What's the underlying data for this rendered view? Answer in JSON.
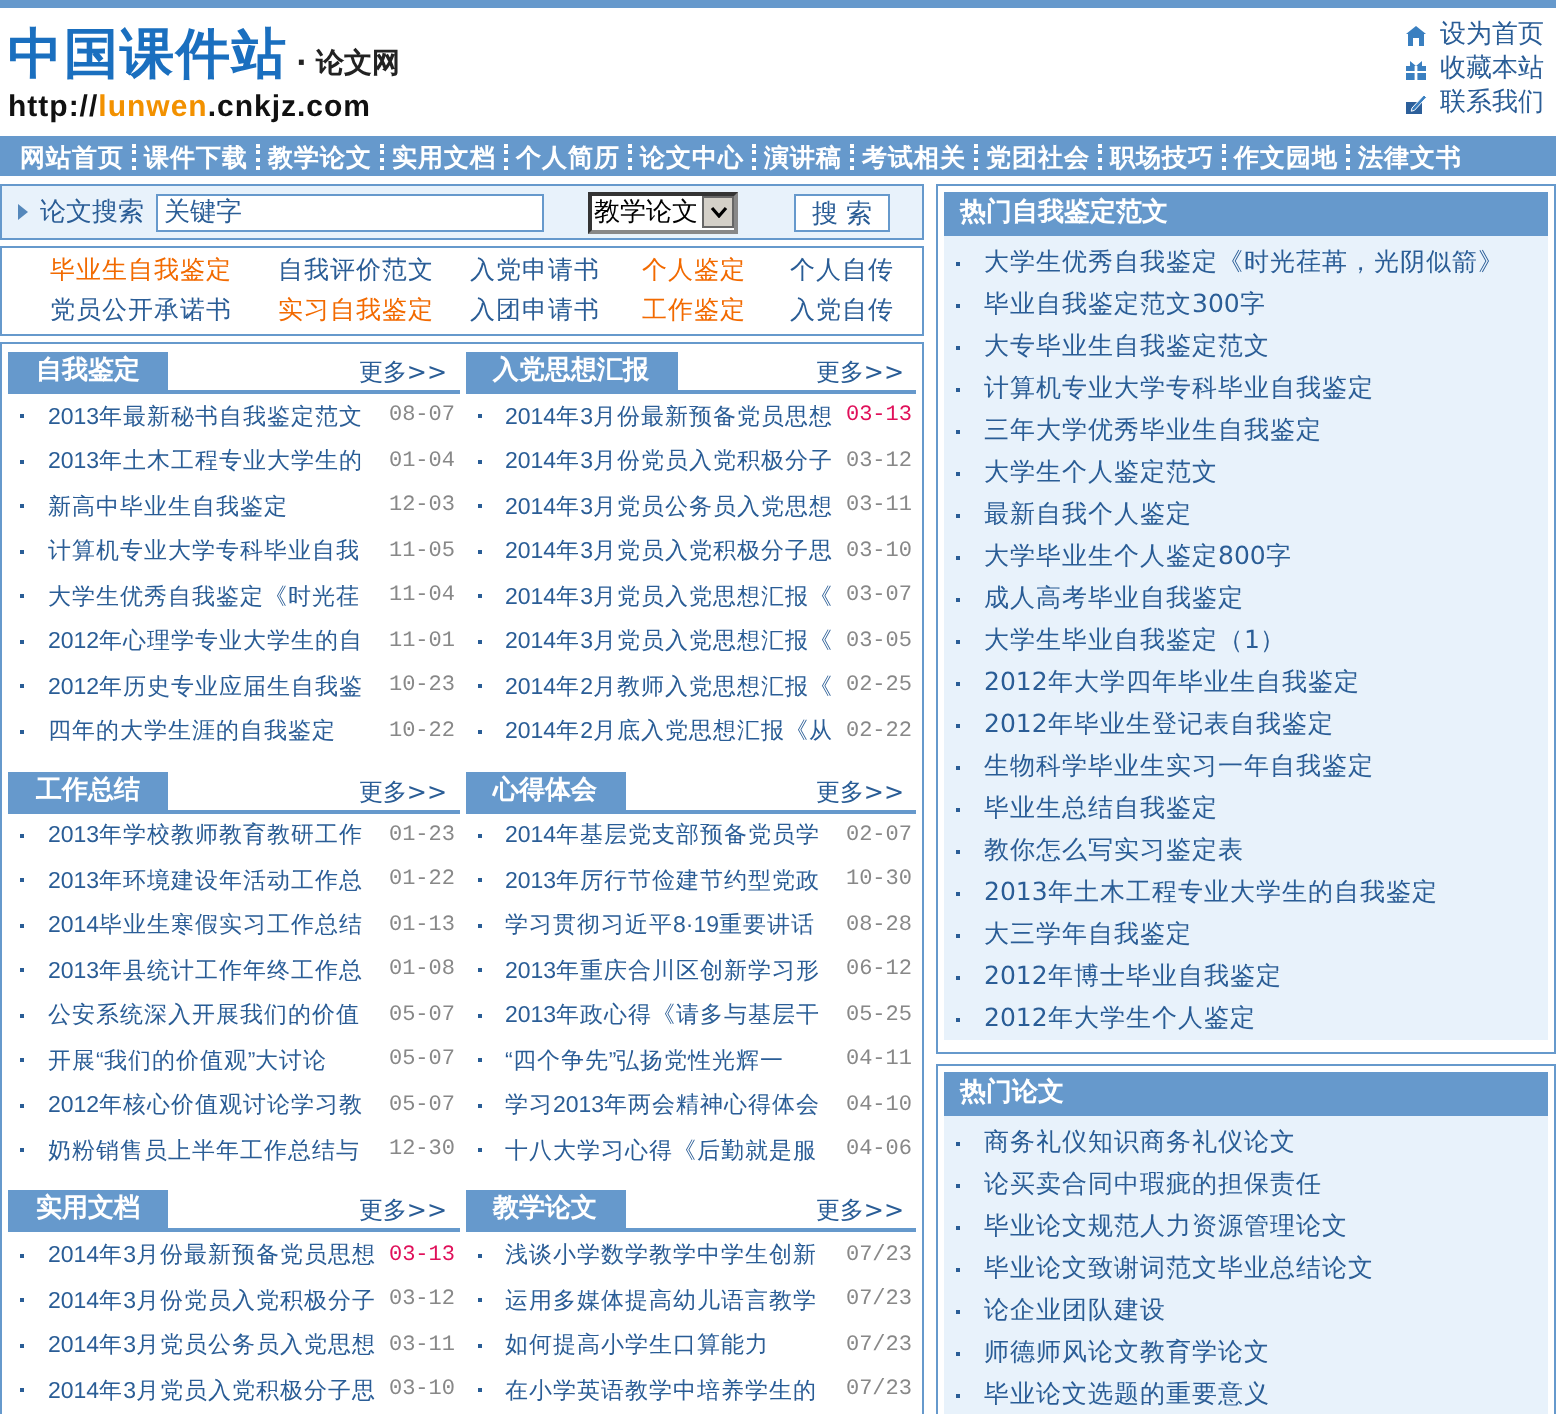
{
  "header": {
    "logo": "中国课件站",
    "logo_sub": "· 论文网",
    "url": [
      {
        "text": "http://",
        "accent": false
      },
      {
        "text": "lunwen",
        "accent": true
      },
      {
        "text": ".cnkjz.com",
        "accent": false
      }
    ],
    "links": [
      {
        "kind": "home",
        "label": "设为首页"
      },
      {
        "kind": "bookmark",
        "label": "收藏本站"
      },
      {
        "kind": "contact",
        "label": "联系我们"
      }
    ]
  },
  "nav": [
    "网站首页",
    "课件下载",
    "教学论文",
    "实用文档",
    "个人简历",
    "论文中心",
    "演讲稿",
    "考试相关",
    "党团社会",
    "职场技巧",
    "作文园地",
    "法律文书"
  ],
  "search": {
    "label": "论文搜索",
    "value": "关键字",
    "category": "教学论文",
    "button": "搜 索"
  },
  "quick_links": [
    {
      "label": "毕业生自我鉴定",
      "highlighted": true
    },
    {
      "label": "自我评价范文",
      "highlighted": false
    },
    {
      "label": "入党申请书",
      "highlighted": false
    },
    {
      "label": "个人鉴定",
      "highlighted": true
    },
    {
      "label": "个人自传",
      "highlighted": false
    },
    {
      "label": "党员公开承诺书",
      "highlighted": false
    },
    {
      "label": "实习自我鉴定",
      "highlighted": true
    },
    {
      "label": "入团申请书",
      "highlighted": false
    },
    {
      "label": "工作鉴定",
      "highlighted": true
    },
    {
      "label": "入党自传",
      "highlighted": false
    }
  ],
  "sections": [
    {
      "title": "自我鉴定",
      "more": "更多>>",
      "items": [
        {
          "title": "2013年最新秘书自我鉴定范文",
          "date": "08-07",
          "highlighted": false
        },
        {
          "title": "2013年土木工程专业大学生的",
          "date": "01-04",
          "highlighted": false
        },
        {
          "title": "新高中毕业生自我鉴定",
          "date": "12-03",
          "highlighted": false
        },
        {
          "title": "计算机专业大学专科毕业自我",
          "date": "11-05",
          "highlighted": false
        },
        {
          "title": "大学生优秀自我鉴定《时光荏",
          "date": "11-04",
          "highlighted": false
        },
        {
          "title": "2012年心理学专业大学生的自",
          "date": "11-01",
          "highlighted": false
        },
        {
          "title": "2012年历史专业应届生自我鉴",
          "date": "10-23",
          "highlighted": false
        },
        {
          "title": "四年的大学生涯的自我鉴定",
          "date": "10-22",
          "highlighted": false
        }
      ]
    },
    {
      "title": "入党思想汇报",
      "more": "更多>>",
      "items": [
        {
          "title": "2014年3月份最新预备党员思想",
          "date": "03-13",
          "highlighted": true
        },
        {
          "title": "2014年3月份党员入党积极分子",
          "date": "03-12",
          "highlighted": false
        },
        {
          "title": "2014年3月党员公务员入党思想",
          "date": "03-11",
          "highlighted": false
        },
        {
          "title": "2014年3月党员入党积极分子思",
          "date": "03-10",
          "highlighted": false
        },
        {
          "title": "2014年3月党员入党思想汇报《",
          "date": "03-07",
          "highlighted": false
        },
        {
          "title": "2014年3月党员入党思想汇报《",
          "date": "03-05",
          "highlighted": false
        },
        {
          "title": "2014年2月教师入党思想汇报《",
          "date": "02-25",
          "highlighted": false
        },
        {
          "title": "2014年2月底入党思想汇报《从",
          "date": "02-22",
          "highlighted": false
        }
      ]
    },
    {
      "title": "工作总结",
      "more": "更多>>",
      "items": [
        {
          "title": "2013年学校教师教育教研工作",
          "date": "01-23",
          "highlighted": false
        },
        {
          "title": "2013年环境建设年活动工作总",
          "date": "01-22",
          "highlighted": false
        },
        {
          "title": "2014毕业生寒假实习工作总结",
          "date": "01-13",
          "highlighted": false
        },
        {
          "title": "2013年县统计工作年终工作总",
          "date": "01-08",
          "highlighted": false
        },
        {
          "title": "公安系统深入开展我们的价值",
          "date": "05-07",
          "highlighted": false
        },
        {
          "title": "开展“我们的价值观”大讨论",
          "date": "05-07",
          "highlighted": false
        },
        {
          "title": "2012年核心价值观讨论学习教",
          "date": "05-07",
          "highlighted": false
        },
        {
          "title": "奶粉销售员上半年工作总结与",
          "date": "12-30",
          "highlighted": false
        }
      ]
    },
    {
      "title": "心得体会",
      "more": "更多>>",
      "items": [
        {
          "title": "2014年基层党支部预备党员学",
          "date": "02-07",
          "highlighted": false
        },
        {
          "title": "2013年厉行节俭建节约型党政",
          "date": "10-30",
          "highlighted": false
        },
        {
          "title": "学习贯彻习近平8·19重要讲话",
          "date": "08-28",
          "highlighted": false
        },
        {
          "title": "2013年重庆合川区创新学习形",
          "date": "06-12",
          "highlighted": false
        },
        {
          "title": "2013年政心得《请多与基层干",
          "date": "05-25",
          "highlighted": false
        },
        {
          "title": "“四个争先”弘扬党性光辉一",
          "date": "04-11",
          "highlighted": false
        },
        {
          "title": "学习2013年两会精神心得体会",
          "date": "04-10",
          "highlighted": false
        },
        {
          "title": "十八大学习心得《后勤就是服",
          "date": "04-06",
          "highlighted": false
        }
      ]
    },
    {
      "title": "实用文档",
      "more": "更多>>",
      "items": [
        {
          "title": "2014年3月份最新预备党员思想",
          "date": "03-13",
          "highlighted": true
        },
        {
          "title": "2014年3月份党员入党积极分子",
          "date": "03-12",
          "highlighted": false
        },
        {
          "title": "2014年3月党员公务员入党思想",
          "date": "03-11",
          "highlighted": false
        },
        {
          "title": "2014年3月党员入党积极分子思",
          "date": "03-10",
          "highlighted": false
        }
      ]
    },
    {
      "title": "教学论文",
      "more": "更多>>",
      "items": [
        {
          "title": "浅谈小学数学教学中学生创新",
          "date": "07/23",
          "highlighted": false
        },
        {
          "title": "运用多媒体提高幼儿语言教学",
          "date": "07/23",
          "highlighted": false
        },
        {
          "title": "如何提高小学生口算能力",
          "date": "07/23",
          "highlighted": false
        },
        {
          "title": "在小学英语教学中培养学生的",
          "date": "07/23",
          "highlighted": false
        }
      ]
    }
  ],
  "side_boxes": [
    {
      "title": "热门自我鉴定范文",
      "items": [
        "大学生优秀自我鉴定《时光荏苒，光阴似箭》",
        "毕业自我鉴定范文300字",
        "大专毕业生自我鉴定范文",
        "计算机专业大学专科毕业自我鉴定",
        "三年大学优秀毕业生自我鉴定",
        "大学生个人鉴定范文",
        "最新自我个人鉴定",
        "大学毕业生个人鉴定800字",
        "成人高考毕业自我鉴定",
        "大学生毕业自我鉴定（1）",
        "2012年大学四年毕业生自我鉴定",
        "2012年毕业生登记表自我鉴定",
        "生物科学毕业生实习一年自我鉴定",
        "毕业生总结自我鉴定",
        "教你怎么写实习鉴定表",
        "2013年土木工程专业大学生的自我鉴定",
        "大三学年自我鉴定",
        "2012年博士毕业自我鉴定",
        "2012年大学生个人鉴定"
      ]
    },
    {
      "title": "热门论文",
      "items": [
        "商务礼仪知识商务礼仪论文",
        "论买卖合同中瑕疵的担保责任",
        "毕业论文规范人力资源管理论文",
        "毕业论文致谢词范文毕业总结论文",
        "论企业团队建设",
        "师德师风论文教育学论文",
        "毕业论文选题的重要意义"
      ]
    }
  ]
}
